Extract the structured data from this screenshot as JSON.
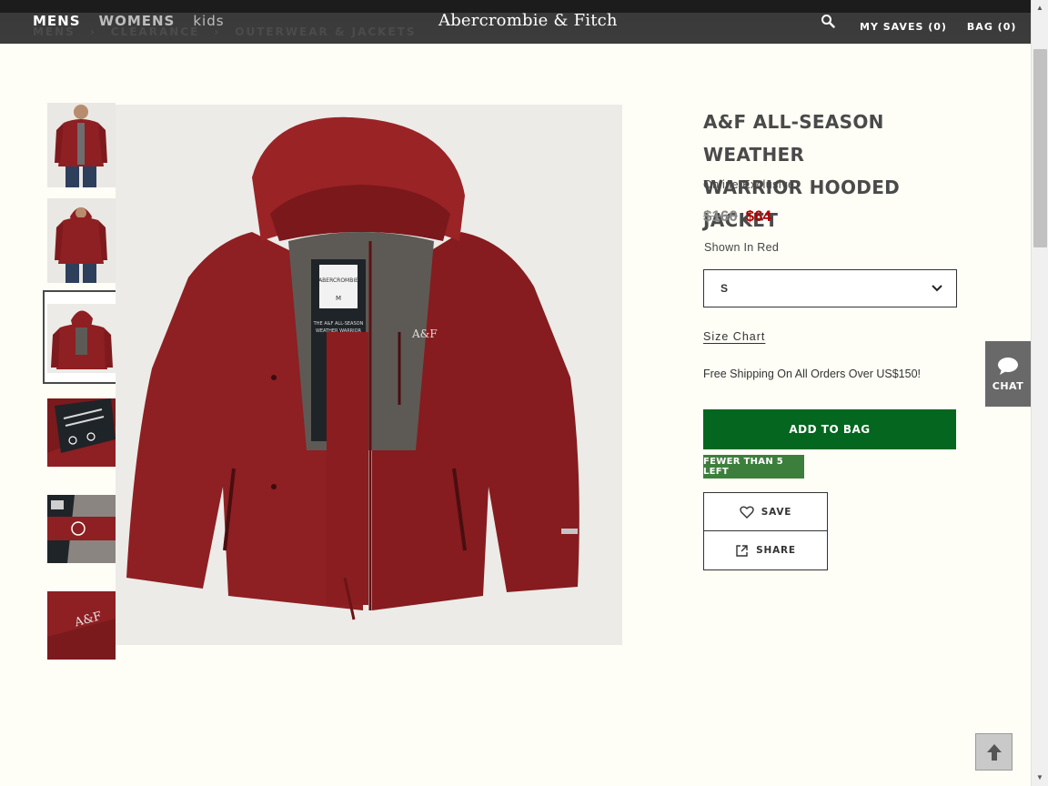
{
  "nav": {
    "mens": "MENS",
    "womens": "WOMENS",
    "kids": "kids",
    "brand": "Abercrombie & Fitch",
    "my_saves": "MY SAVES (0)",
    "bag": "BAG (0)"
  },
  "breadcrumb": [
    "MENS",
    "CLEARANCE",
    "OUTERWEAR & JACKETS"
  ],
  "product": {
    "title_line1": "A&F ALL-SEASON WEATHER",
    "title_line2": "WARRIOR HOODED JACKET",
    "exclusive": "Online Exclusive",
    "price_old": "$160",
    "price_new": "$64",
    "shown_in": "Shown In Red",
    "size_selected": "S",
    "size_chart": "Size Chart",
    "shipping": "Free Shipping On All Orders Over US$150!",
    "add_to_bag": "ADD TO BAG",
    "stock_badge": "FEWER THAN 5 LEFT",
    "save": "SAVE",
    "share": "SHARE"
  },
  "label_text": {
    "brand_tag": "ABERCROMBIE",
    "size_tag": "M",
    "logo": "A&F",
    "tag_line1": "THE A&F ALL-SEASON",
    "tag_line2": "WEATHER WARRIOR"
  },
  "chat": {
    "label": "CHAT"
  },
  "colors": {
    "jacket": "#8e1f22",
    "add_to_bag": "#04661f",
    "stock_badge": "#3c7f3c",
    "sale_price": "#b30000"
  }
}
